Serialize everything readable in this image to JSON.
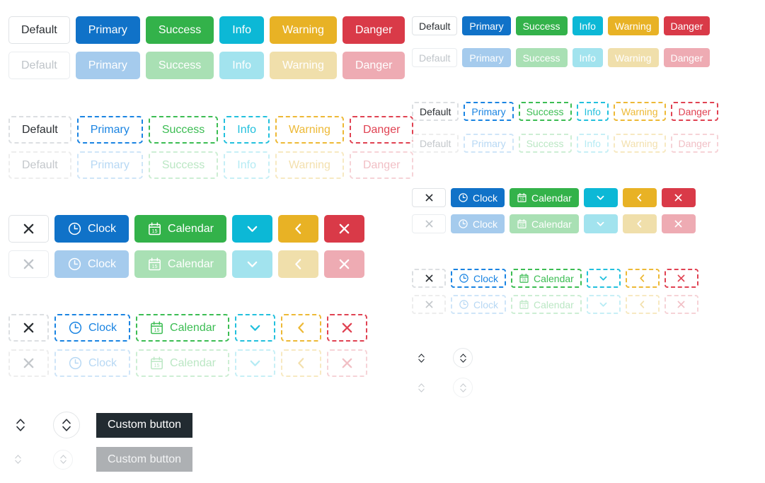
{
  "palette": {
    "default": "#ffffff",
    "default_border": "#dfe2e5",
    "primary": "#1072c8",
    "success": "#33b24a",
    "info": "#0cb8d6",
    "warning": "#e8b225",
    "danger": "#d93a48",
    "custom_dark": "#222b31",
    "custom_disabled": "#adb0b3",
    "text_dark": "#2b2f33",
    "text_light": "#ffffff"
  },
  "labels": {
    "default": "Default",
    "primary": "Primary",
    "success": "Success",
    "info": "Info",
    "warning": "Warning",
    "danger": "Danger",
    "clock": "Clock",
    "calendar": "Calendar",
    "custom_button": "Custom button",
    "calendar_day": "15"
  },
  "icons": {
    "close": "close-icon",
    "clock": "clock-icon",
    "calendar": "calendar-icon",
    "chevron_down": "chevron-down-icon",
    "chevron_left": "chevron-left-icon",
    "sort": "sort-updown-icon"
  },
  "sections": {
    "left": {
      "solid_enabled": [
        "Default",
        "Primary",
        "Success",
        "Info",
        "Warning",
        "Danger"
      ],
      "solid_disabled": [
        "Default",
        "Primary",
        "Success",
        "Info",
        "Warning",
        "Danger"
      ],
      "dashed_enabled": [
        "Default",
        "Primary",
        "Success",
        "Info",
        "Warning",
        "Danger"
      ],
      "dashed_disabled": [
        "Default",
        "Primary",
        "Success",
        "Info",
        "Warning",
        "Danger"
      ],
      "icon_solid_enabled": [
        "",
        "Clock",
        "Calendar",
        "",
        "",
        ""
      ],
      "icon_solid_disabled": [
        "",
        "Clock",
        "Calendar",
        "",
        "",
        ""
      ],
      "icon_dashed_enabled": [
        "",
        "Clock",
        "Calendar",
        "",
        "",
        ""
      ],
      "icon_dashed_disabled": [
        "",
        "Clock",
        "Calendar",
        "",
        "",
        ""
      ],
      "custom_enabled": "Custom button",
      "custom_disabled": "Custom button"
    },
    "right": {
      "solid_enabled": [
        "Default",
        "Primary",
        "Success",
        "Info",
        "Warning",
        "Danger"
      ],
      "solid_disabled": [
        "Default",
        "Primary",
        "Success",
        "Info",
        "Warning",
        "Danger"
      ],
      "dashed_enabled": [
        "Default",
        "Primary",
        "Success",
        "Info",
        "Warning",
        "Danger"
      ],
      "dashed_disabled": [
        "Default",
        "Primary",
        "Success",
        "Info",
        "Warning",
        "Danger"
      ],
      "icon_solid_enabled": [
        "",
        "Clock",
        "Calendar",
        "",
        "",
        ""
      ],
      "icon_solid_disabled": [
        "",
        "Clock",
        "Calendar",
        "",
        "",
        ""
      ],
      "icon_dashed_enabled": [
        "",
        "Clock",
        "Calendar",
        "",
        "",
        ""
      ],
      "icon_dashed_disabled": [
        "",
        "Clock",
        "Calendar",
        "",
        "",
        ""
      ]
    }
  }
}
